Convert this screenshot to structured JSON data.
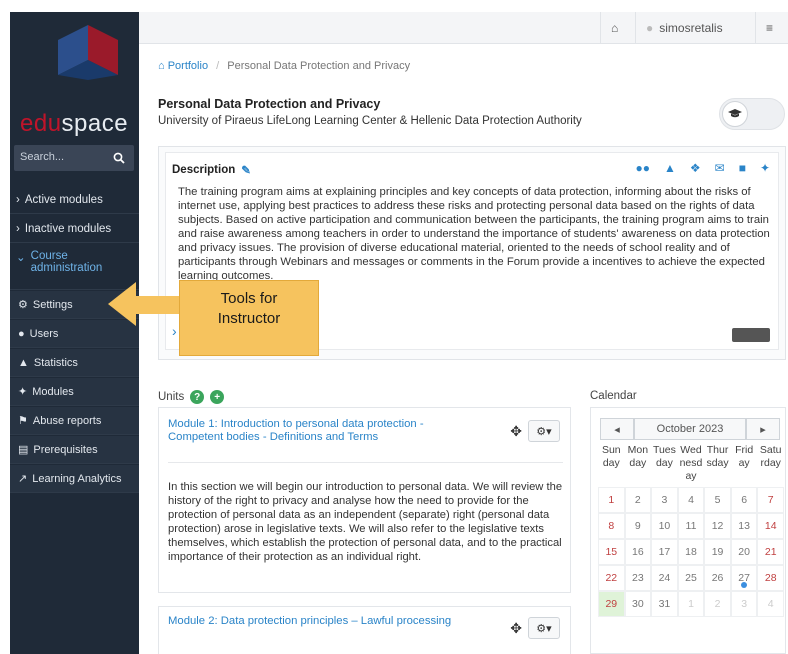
{
  "sidebar": {
    "brand_prefix": "edu",
    "brand_suffix": "space",
    "search_placeholder": "Search...",
    "items": [
      {
        "label": "Active modules",
        "icon": "chevron-right-icon"
      },
      {
        "label": "Inactive modules",
        "icon": "chevron-right-icon"
      },
      {
        "label": "Course administration",
        "icon": "chevron-down-icon"
      },
      {
        "label": "Settings",
        "icon": "gears-icon"
      },
      {
        "label": "Users",
        "icon": "user-icon"
      },
      {
        "label": "Statistics",
        "icon": "area-chart-icon"
      },
      {
        "label": "Modules",
        "icon": "wrench-icon"
      },
      {
        "label": "Abuse reports",
        "icon": "flag-icon"
      },
      {
        "label": "Prerequisites",
        "icon": "institution-icon"
      },
      {
        "label": "Learning Analytics",
        "icon": "line-chart-icon"
      }
    ]
  },
  "topbar": {
    "username": "simosretalis"
  },
  "breadcrumb": {
    "home": "Portfolio",
    "separator": "/",
    "current": "Personal Data Protection and Privacy"
  },
  "course": {
    "title": "Personal Data Protection and Privacy",
    "subtitle": "University of Piraeus LifeLong Learning Center & Hellenic Data Protection Authority"
  },
  "description": {
    "label": "Description",
    "text": "The training program aims at explaining principles and key concepts of data protection, informing about the risks of internet use, applying best practices to address these risks and protecting personal data based on the rights of data subjects. Based on active participation and communication between the participants, the training program aims to train and raise awareness among teachers in order to understand the importance of students' awareness on data protection and privacy issues. The provision of diverse educational material, oriented to the needs of school reality and of participants through Webinars and messages or comments in the Forum provide a incentives to achieve the expected learning outcomes."
  },
  "callout": {
    "line1": "Tools for",
    "line2": "Instructor"
  },
  "units": {
    "label": "Units",
    "items": [
      {
        "title": "Module 1: Introduction to personal data protection - Competent bodies - Definitions and Terms",
        "text": "In this section we will begin our introduction to personal data. We will review the history of the right to privacy and analyse how the need to provide for the protection of personal data as an independent (separate) right (personal data protection) arose in legislative texts. We will also refer to the legislative texts themselves, which establish the protection of personal data, and to the practical importance of their protection as an individual right."
      },
      {
        "title": "Module 2: Data protection principles – Lawful processing",
        "text": ""
      }
    ]
  },
  "calendar": {
    "label": "Calendar",
    "prev": "◂",
    "next": "▸",
    "month": "October 2023",
    "days": [
      "Sun day",
      "Mon day",
      "Tues day",
      "Wed nesd ay",
      "Thur sday",
      "Frid ay",
      "Satu rday"
    ],
    "weeks": [
      [
        "1",
        "2",
        "3",
        "4",
        "5",
        "6",
        "7"
      ],
      [
        "8",
        "9",
        "10",
        "11",
        "12",
        "13",
        "14"
      ],
      [
        "15",
        "16",
        "17",
        "18",
        "19",
        "20",
        "21"
      ],
      [
        "22",
        "23",
        "24",
        "25",
        "26",
        "27",
        "28"
      ],
      [
        "29",
        "30",
        "31",
        "1",
        "2",
        "3",
        "4"
      ]
    ]
  },
  "colors": {
    "sidebar_bg": "#1f2a38",
    "accent": "#2a84c8",
    "brand_red": "#c0142a",
    "callout": "#f6c35e"
  }
}
